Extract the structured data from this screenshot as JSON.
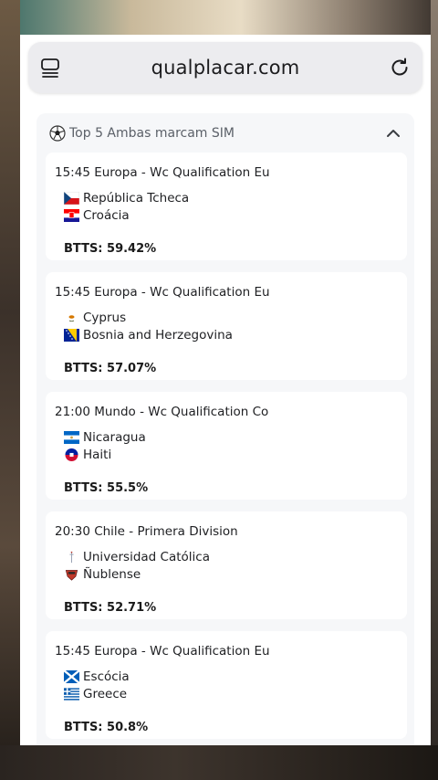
{
  "browser": {
    "url": "qualplacar.com"
  },
  "section": {
    "title": "Top 5 Ambas marcam SIM"
  },
  "matches": [
    {
      "header": "15:45 Europa - Wc Qualification Eu",
      "home": {
        "name": "República Tcheca",
        "flag": "czech-flag"
      },
      "away": {
        "name": "Croácia",
        "flag": "croatia-flag"
      },
      "btts": "BTTS: 59.42%"
    },
    {
      "header": "15:45 Europa - Wc Qualification Eu",
      "home": {
        "name": "Cyprus",
        "flag": "cyprus-flag"
      },
      "away": {
        "name": "Bosnia and Herzegovina",
        "flag": "bosnia-flag"
      },
      "btts": "BTTS: 57.07%"
    },
    {
      "header": "21:00 Mundo - Wc Qualification Co",
      "home": {
        "name": "Nicaragua",
        "flag": "nicaragua-flag"
      },
      "away": {
        "name": "Haiti",
        "flag": "haiti-flag"
      },
      "btts": "BTTS: 55.5%"
    },
    {
      "header": "20:30 Chile - Primera Division",
      "home": {
        "name": "Universidad Católica",
        "flag": "universidad-catolica-crest"
      },
      "away": {
        "name": "Ñublense",
        "flag": "nublense-crest"
      },
      "btts": "BTTS: 52.71%"
    },
    {
      "header": "15:45 Europa - Wc Qualification Eu",
      "home": {
        "name": "Escócia",
        "flag": "scotland-flag"
      },
      "away": {
        "name": "Greece",
        "flag": "greece-flag"
      },
      "btts": "BTTS: 50.8%"
    }
  ]
}
